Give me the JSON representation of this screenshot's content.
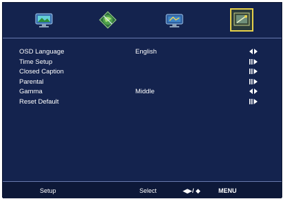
{
  "tabs": [
    {
      "icon": "tv-picture-icon",
      "active": false
    },
    {
      "icon": "globe-icon",
      "active": false
    },
    {
      "icon": "channel-icon",
      "active": false
    },
    {
      "icon": "setup-icon",
      "active": true
    }
  ],
  "menu": {
    "items": [
      {
        "label": "OSD Language",
        "value": "English",
        "arrow": "◀▶"
      },
      {
        "label": "Time Setup",
        "value": "",
        "arrow": "⏸▶"
      },
      {
        "label": "Closed Caption",
        "value": "",
        "arrow": "⏸▶"
      },
      {
        "label": "Parental",
        "value": "",
        "arrow": "⏸▶"
      },
      {
        "label": "Gamma",
        "value": "Middle",
        "arrow": "◀▶"
      },
      {
        "label": "Reset Default",
        "value": "",
        "arrow": "⏸▶"
      }
    ]
  },
  "footer": {
    "title": "Setup",
    "select": "Select",
    "nav": "◀▶/ ◆",
    "menu": "MENU"
  },
  "colors": {
    "background": "#14234e",
    "accent": "#e8d24a"
  }
}
